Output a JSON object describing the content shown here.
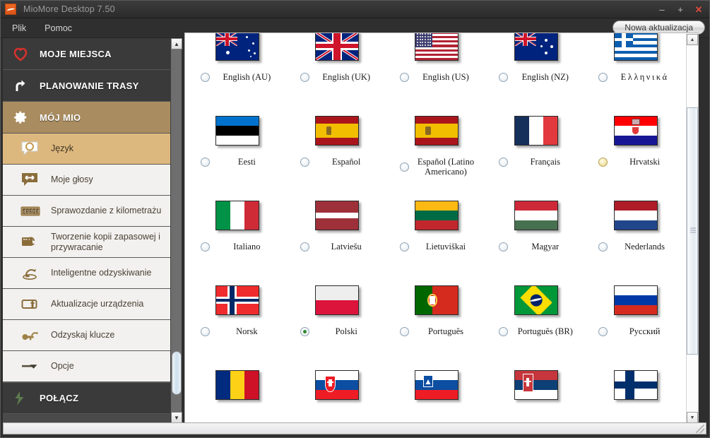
{
  "window": {
    "title": "MioMore Desktop 7.50",
    "icon": "app-icon",
    "minimize": "–",
    "maximize": "+",
    "close": "✕"
  },
  "menubar": {
    "items": [
      {
        "label": "Plik"
      },
      {
        "label": "Pomoc"
      }
    ],
    "update_button": "Nowa aktualizacja"
  },
  "sidebar": {
    "items": [
      {
        "label": "MOJE MIEJSCA",
        "icon": "heart-icon",
        "level": "top",
        "state": "normal"
      },
      {
        "label": "PLANOWANIE TRASY",
        "icon": "route-arrow-icon",
        "level": "top",
        "state": "normal"
      },
      {
        "label": "MÓJ MIO",
        "icon": "gear-icon",
        "level": "top",
        "state": "active"
      },
      {
        "label": "Język",
        "icon": "language-bubble-icon",
        "level": "sub",
        "state": "selected"
      },
      {
        "label": "Moje głosy",
        "icon": "voice-bubble-icon",
        "level": "sub",
        "state": "normal"
      },
      {
        "label": "Sprawozdanie z kilometrażu",
        "icon": "odometer-icon",
        "level": "sub",
        "state": "normal"
      },
      {
        "label": "Tworzenie kopii zapasowej i przywracanie",
        "icon": "backup-restore-icon",
        "level": "sub",
        "state": "normal"
      },
      {
        "label": "Inteligentne odzyskiwanie",
        "icon": "smart-recovery-icon",
        "level": "sub",
        "state": "normal"
      },
      {
        "label": "Aktualizacje urządzenia",
        "icon": "device-update-icon",
        "level": "sub",
        "state": "normal"
      },
      {
        "label": "Odzyskaj klucze",
        "icon": "key-icon",
        "level": "sub",
        "state": "normal"
      },
      {
        "label": "Opcje",
        "icon": "options-arrow-icon",
        "level": "sub",
        "state": "normal"
      },
      {
        "label": "POŁĄCZ",
        "icon": "connect-icon",
        "level": "top",
        "state": "bottom"
      }
    ]
  },
  "scrollbars": {
    "sidebar": {
      "up_arrow": "▲",
      "down_arrow": "▼"
    },
    "content": {
      "up_arrow": "▲",
      "down_arrow": "▼"
    }
  },
  "languages": [
    {
      "label": "English (AU)",
      "flag": "au",
      "selected": false,
      "hover": false
    },
    {
      "label": "English (UK)",
      "flag": "uk",
      "selected": false,
      "hover": false
    },
    {
      "label": "English (US)",
      "flag": "us",
      "selected": false,
      "hover": false
    },
    {
      "label": "English (NZ)",
      "flag": "nz",
      "selected": false,
      "hover": false
    },
    {
      "label": "Ελληνικά",
      "flag": "gr",
      "selected": false,
      "hover": false,
      "greek": true
    },
    {
      "label": "Eesti",
      "flag": "ee",
      "selected": false,
      "hover": false
    },
    {
      "label": "Español",
      "flag": "es",
      "selected": false,
      "hover": false
    },
    {
      "label": "Español (Latino Americano)",
      "flag": "es",
      "selected": false,
      "hover": false
    },
    {
      "label": "Français",
      "flag": "fr",
      "selected": false,
      "hover": false
    },
    {
      "label": "Hrvatski",
      "flag": "hr",
      "selected": false,
      "hover": true
    },
    {
      "label": "Italiano",
      "flag": "it",
      "selected": false,
      "hover": false
    },
    {
      "label": "Latviešu",
      "flag": "lv",
      "selected": false,
      "hover": false
    },
    {
      "label": "Lietuviškai",
      "flag": "lt",
      "selected": false,
      "hover": false
    },
    {
      "label": "Magyar",
      "flag": "hu",
      "selected": false,
      "hover": false
    },
    {
      "label": "Nederlands",
      "flag": "nl",
      "selected": false,
      "hover": false
    },
    {
      "label": "Norsk",
      "flag": "no",
      "selected": false,
      "hover": false
    },
    {
      "label": "Polski",
      "flag": "pl",
      "selected": true,
      "hover": false
    },
    {
      "label": "Português",
      "flag": "pt",
      "selected": false,
      "hover": false
    },
    {
      "label": "Português (BR)",
      "flag": "br",
      "selected": false,
      "hover": false
    },
    {
      "label": "Русский",
      "flag": "ru",
      "selected": false,
      "hover": false
    },
    {
      "label": "",
      "flag": "ro",
      "selected": false,
      "hover": false
    },
    {
      "label": "",
      "flag": "sk",
      "selected": false,
      "hover": false
    },
    {
      "label": "",
      "flag": "si",
      "selected": false,
      "hover": false
    },
    {
      "label": "",
      "flag": "rs",
      "selected": false,
      "hover": false
    },
    {
      "label": "",
      "flag": "fi",
      "selected": false,
      "hover": false
    }
  ],
  "colors": {
    "accent_brown": "#a98c5f",
    "selected_tan": "#ddb87e",
    "sidebar_dark": "#3a3a3a",
    "radio_checked": "#2f8a2f"
  }
}
